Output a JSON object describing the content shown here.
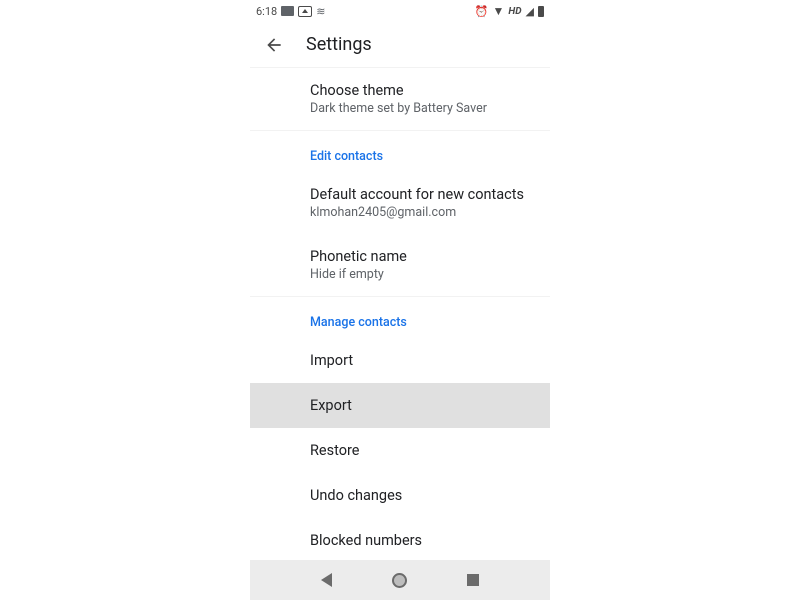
{
  "status": {
    "time": "6:18",
    "hd": "HD"
  },
  "appbar": {
    "title": "Settings"
  },
  "sections": {
    "theme": {
      "title": "Choose theme",
      "subtitle": "Dark theme set by Battery Saver"
    },
    "edit_contacts": {
      "header": "Edit contacts",
      "default_account": {
        "title": "Default account for new contacts",
        "subtitle": "klmohan2405@gmail.com"
      },
      "phonetic": {
        "title": "Phonetic name",
        "subtitle": "Hide if empty"
      }
    },
    "manage_contacts": {
      "header": "Manage contacts",
      "import": "Import",
      "export": "Export",
      "restore": "Restore",
      "undo": "Undo changes",
      "blocked": "Blocked numbers"
    }
  }
}
